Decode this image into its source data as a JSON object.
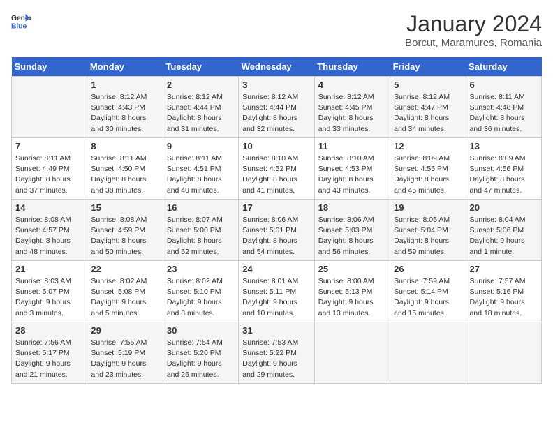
{
  "header": {
    "logo_general": "General",
    "logo_blue": "Blue",
    "title": "January 2024",
    "location": "Borcut, Maramures, Romania"
  },
  "days_of_week": [
    "Sunday",
    "Monday",
    "Tuesday",
    "Wednesday",
    "Thursday",
    "Friday",
    "Saturday"
  ],
  "weeks": [
    [
      {
        "day": "",
        "sunrise": "",
        "sunset": "",
        "daylight": "",
        "empty": true
      },
      {
        "day": "1",
        "sunrise": "Sunrise: 8:12 AM",
        "sunset": "Sunset: 4:43 PM",
        "daylight": "Daylight: 8 hours and 30 minutes."
      },
      {
        "day": "2",
        "sunrise": "Sunrise: 8:12 AM",
        "sunset": "Sunset: 4:44 PM",
        "daylight": "Daylight: 8 hours and 31 minutes."
      },
      {
        "day": "3",
        "sunrise": "Sunrise: 8:12 AM",
        "sunset": "Sunset: 4:44 PM",
        "daylight": "Daylight: 8 hours and 32 minutes."
      },
      {
        "day": "4",
        "sunrise": "Sunrise: 8:12 AM",
        "sunset": "Sunset: 4:45 PM",
        "daylight": "Daylight: 8 hours and 33 minutes."
      },
      {
        "day": "5",
        "sunrise": "Sunrise: 8:12 AM",
        "sunset": "Sunset: 4:47 PM",
        "daylight": "Daylight: 8 hours and 34 minutes."
      },
      {
        "day": "6",
        "sunrise": "Sunrise: 8:11 AM",
        "sunset": "Sunset: 4:48 PM",
        "daylight": "Daylight: 8 hours and 36 minutes."
      }
    ],
    [
      {
        "day": "7",
        "sunrise": "Sunrise: 8:11 AM",
        "sunset": "Sunset: 4:49 PM",
        "daylight": "Daylight: 8 hours and 37 minutes."
      },
      {
        "day": "8",
        "sunrise": "Sunrise: 8:11 AM",
        "sunset": "Sunset: 4:50 PM",
        "daylight": "Daylight: 8 hours and 38 minutes."
      },
      {
        "day": "9",
        "sunrise": "Sunrise: 8:11 AM",
        "sunset": "Sunset: 4:51 PM",
        "daylight": "Daylight: 8 hours and 40 minutes."
      },
      {
        "day": "10",
        "sunrise": "Sunrise: 8:10 AM",
        "sunset": "Sunset: 4:52 PM",
        "daylight": "Daylight: 8 hours and 41 minutes."
      },
      {
        "day": "11",
        "sunrise": "Sunrise: 8:10 AM",
        "sunset": "Sunset: 4:53 PM",
        "daylight": "Daylight: 8 hours and 43 minutes."
      },
      {
        "day": "12",
        "sunrise": "Sunrise: 8:09 AM",
        "sunset": "Sunset: 4:55 PM",
        "daylight": "Daylight: 8 hours and 45 minutes."
      },
      {
        "day": "13",
        "sunrise": "Sunrise: 8:09 AM",
        "sunset": "Sunset: 4:56 PM",
        "daylight": "Daylight: 8 hours and 47 minutes."
      }
    ],
    [
      {
        "day": "14",
        "sunrise": "Sunrise: 8:08 AM",
        "sunset": "Sunset: 4:57 PM",
        "daylight": "Daylight: 8 hours and 48 minutes."
      },
      {
        "day": "15",
        "sunrise": "Sunrise: 8:08 AM",
        "sunset": "Sunset: 4:59 PM",
        "daylight": "Daylight: 8 hours and 50 minutes."
      },
      {
        "day": "16",
        "sunrise": "Sunrise: 8:07 AM",
        "sunset": "Sunset: 5:00 PM",
        "daylight": "Daylight: 8 hours and 52 minutes."
      },
      {
        "day": "17",
        "sunrise": "Sunrise: 8:06 AM",
        "sunset": "Sunset: 5:01 PM",
        "daylight": "Daylight: 8 hours and 54 minutes."
      },
      {
        "day": "18",
        "sunrise": "Sunrise: 8:06 AM",
        "sunset": "Sunset: 5:03 PM",
        "daylight": "Daylight: 8 hours and 56 minutes."
      },
      {
        "day": "19",
        "sunrise": "Sunrise: 8:05 AM",
        "sunset": "Sunset: 5:04 PM",
        "daylight": "Daylight: 8 hours and 59 minutes."
      },
      {
        "day": "20",
        "sunrise": "Sunrise: 8:04 AM",
        "sunset": "Sunset: 5:06 PM",
        "daylight": "Daylight: 9 hours and 1 minute."
      }
    ],
    [
      {
        "day": "21",
        "sunrise": "Sunrise: 8:03 AM",
        "sunset": "Sunset: 5:07 PM",
        "daylight": "Daylight: 9 hours and 3 minutes."
      },
      {
        "day": "22",
        "sunrise": "Sunrise: 8:02 AM",
        "sunset": "Sunset: 5:08 PM",
        "daylight": "Daylight: 9 hours and 5 minutes."
      },
      {
        "day": "23",
        "sunrise": "Sunrise: 8:02 AM",
        "sunset": "Sunset: 5:10 PM",
        "daylight": "Daylight: 9 hours and 8 minutes."
      },
      {
        "day": "24",
        "sunrise": "Sunrise: 8:01 AM",
        "sunset": "Sunset: 5:11 PM",
        "daylight": "Daylight: 9 hours and 10 minutes."
      },
      {
        "day": "25",
        "sunrise": "Sunrise: 8:00 AM",
        "sunset": "Sunset: 5:13 PM",
        "daylight": "Daylight: 9 hours and 13 minutes."
      },
      {
        "day": "26",
        "sunrise": "Sunrise: 7:59 AM",
        "sunset": "Sunset: 5:14 PM",
        "daylight": "Daylight: 9 hours and 15 minutes."
      },
      {
        "day": "27",
        "sunrise": "Sunrise: 7:57 AM",
        "sunset": "Sunset: 5:16 PM",
        "daylight": "Daylight: 9 hours and 18 minutes."
      }
    ],
    [
      {
        "day": "28",
        "sunrise": "Sunrise: 7:56 AM",
        "sunset": "Sunset: 5:17 PM",
        "daylight": "Daylight: 9 hours and 21 minutes."
      },
      {
        "day": "29",
        "sunrise": "Sunrise: 7:55 AM",
        "sunset": "Sunset: 5:19 PM",
        "daylight": "Daylight: 9 hours and 23 minutes."
      },
      {
        "day": "30",
        "sunrise": "Sunrise: 7:54 AM",
        "sunset": "Sunset: 5:20 PM",
        "daylight": "Daylight: 9 hours and 26 minutes."
      },
      {
        "day": "31",
        "sunrise": "Sunrise: 7:53 AM",
        "sunset": "Sunset: 5:22 PM",
        "daylight": "Daylight: 9 hours and 29 minutes."
      },
      {
        "day": "",
        "sunrise": "",
        "sunset": "",
        "daylight": "",
        "empty": true
      },
      {
        "day": "",
        "sunrise": "",
        "sunset": "",
        "daylight": "",
        "empty": true
      },
      {
        "day": "",
        "sunrise": "",
        "sunset": "",
        "daylight": "",
        "empty": true
      }
    ]
  ]
}
